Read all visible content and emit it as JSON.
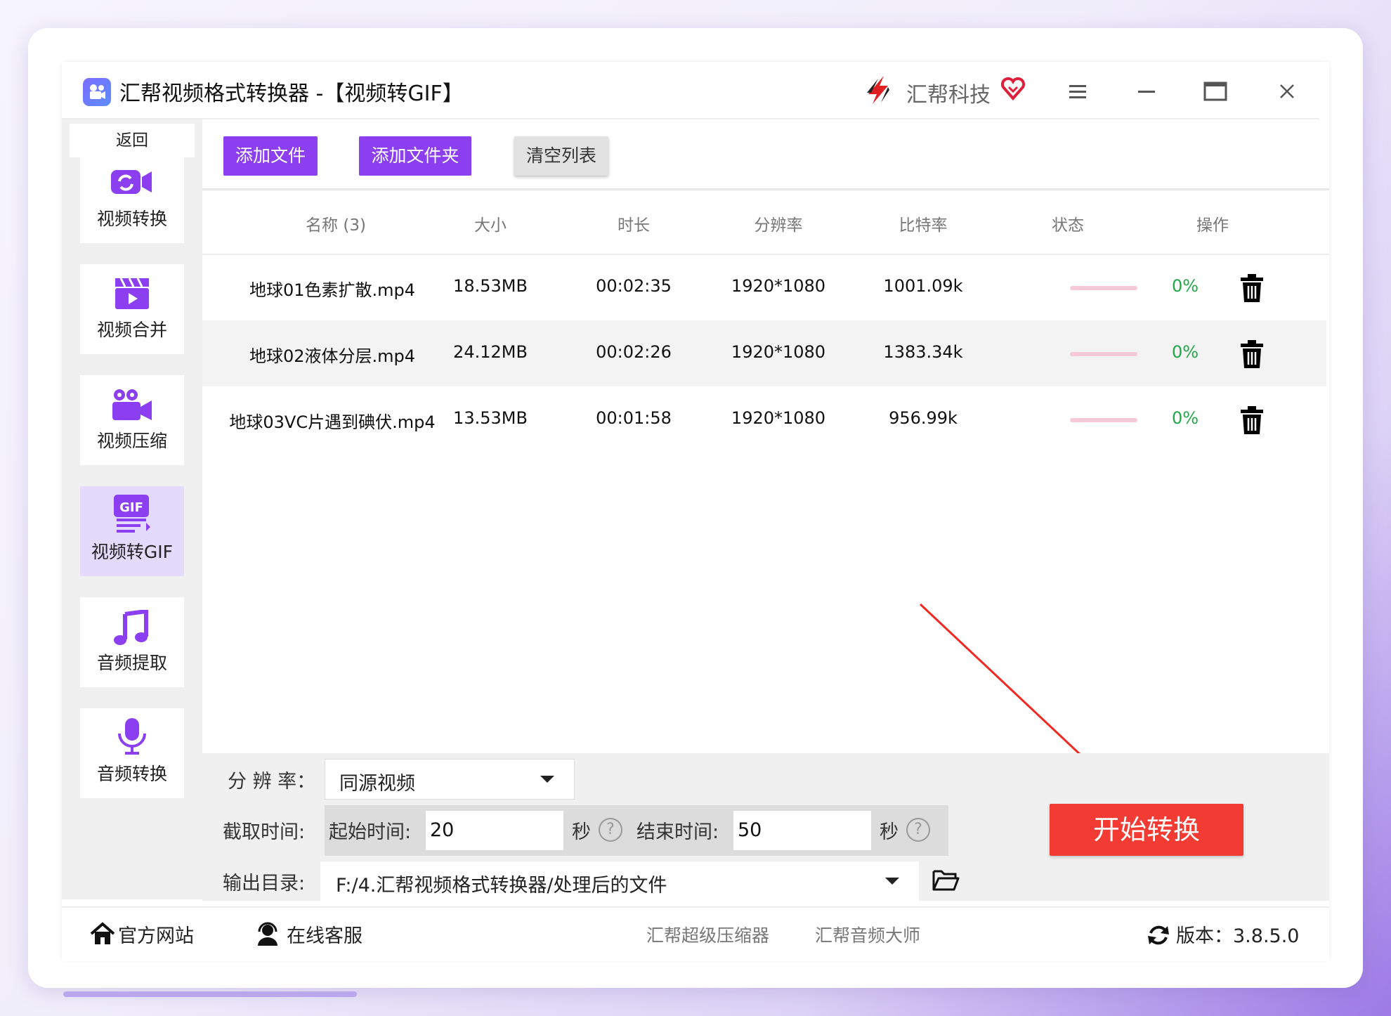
{
  "window": {
    "title": "汇帮视频格式转换器  -【视频转GIF】",
    "brand": "汇帮科技"
  },
  "sidebar": {
    "back": "返回",
    "items": [
      {
        "label": "视频转换",
        "icon": "video-convert-icon",
        "active": false
      },
      {
        "label": "视频合并",
        "icon": "video-merge-icon",
        "active": false
      },
      {
        "label": "视频压缩",
        "icon": "video-compress-icon",
        "active": false
      },
      {
        "label": "视频转GIF",
        "icon": "gif-icon",
        "active": true
      },
      {
        "label": "音频提取",
        "icon": "music-note-icon",
        "active": false
      },
      {
        "label": "音频转换",
        "icon": "microphone-icon",
        "active": false
      }
    ]
  },
  "toolbar": {
    "add_file": "添加文件",
    "add_folder": "添加文件夹",
    "clear_list": "清空列表"
  },
  "table": {
    "headers": [
      "名称 (3)",
      "大小",
      "时长",
      "分辨率",
      "比特率",
      "状态",
      "操作"
    ],
    "rows": [
      {
        "name": "地球01色素扩散.mp4",
        "size": "18.53MB",
        "duration": "00:02:35",
        "resolution": "1920*1080",
        "bitrate": "1001.09k",
        "progress": "0%"
      },
      {
        "name": "地球02液体分层.mp4",
        "size": "24.12MB",
        "duration": "00:02:26",
        "resolution": "1920*1080",
        "bitrate": "1383.34k",
        "progress": "0%"
      },
      {
        "name": "地球03VC片遇到碘伏.mp4",
        "size": "13.53MB",
        "duration": "00:01:58",
        "resolution": "1920*1080",
        "bitrate": "956.99k",
        "progress": "0%"
      }
    ]
  },
  "settings": {
    "resolution_label": "分 辨 率：",
    "resolution_value": "同源视频",
    "clip_label": "截取时间:",
    "start_label": "起始时间:",
    "start_value": "20",
    "end_label": "结束时间:",
    "end_value": "50",
    "seconds_unit": "秒",
    "help": "?",
    "output_label": "输出目录:",
    "output_value": "F:/4.汇帮视频格式转换器/处理后的文件"
  },
  "start_button": "开始转换",
  "footer": {
    "website": "官方网站",
    "support": "在线客服",
    "compressor": "汇帮超级压缩器",
    "audio_master": "汇帮音频大师",
    "version": "版本：3.8.5.0"
  },
  "colors": {
    "accent": "#8b3ff0",
    "start_button": "#f23b33",
    "active_nav": "#e4dafb",
    "progress_text": "#22a84a"
  }
}
